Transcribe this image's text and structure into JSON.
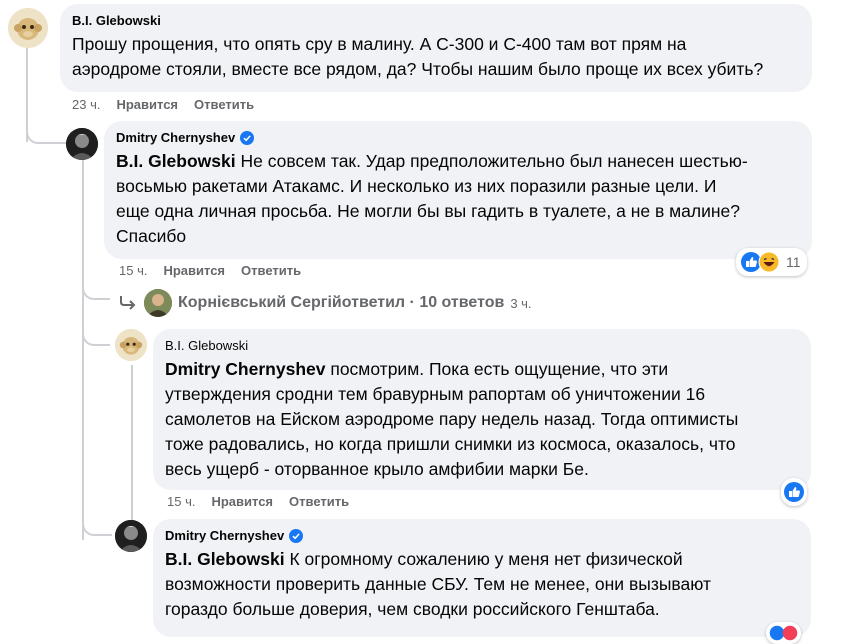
{
  "comment1": {
    "author": "B.I. Glebowski",
    "text": "Прошу прощения, что опять сру в малину. А С-300 и С-400 там вот прям на аэродроме стояли, вместе все рядом, да? Чтобы нашим было проще их всех убить?",
    "line1": "Прошу прощения, что опять сру в малину. А С-300 и С-400 там вот прям на",
    "line2": "аэродроме стояли, вместе все рядом, да? Чтобы нашим было проще их всех убить?",
    "time": "23 ч.",
    "like": "Нравится",
    "reply": "Ответить"
  },
  "comment2": {
    "author": "Dmitry Chernyshev",
    "mention": "B.I. Glebowski",
    "line1": " Не совсем так. Удар предположительно был нанесен шестью-",
    "line2": "восьмью ракетами Атакамс. И несколько из них поразили разные цели. И",
    "line3": "еще одна личная просьба. Не могли бы вы гадить в туалете, а не в малине?",
    "line4": "Спасибо",
    "time": "15 ч.",
    "like": "Нравится",
    "reply": "Ответить",
    "reaction_count": "11"
  },
  "replies_summary": {
    "author": "Корнієвський Сергій",
    "text": " ответил · 10 ответов",
    "time": "3 ч."
  },
  "comment3": {
    "author": "B.I. Glebowski",
    "mention": "Dmitry Chernyshev",
    "line1": " посмотрим. Пока есть ощущение, что эти",
    "line2": "утверждения сродни тем бравурным рапортам об уничтожении 16",
    "line3": "самолетов на Ейском аэродроме пару недель назад. Тогда оптимисты",
    "line4": "тоже радовались, но когда пришли снимки из космоса, оказалось, что",
    "line5": "весь ущерб - оторванное крыло амфибии марки Бе.",
    "time": "15 ч.",
    "like": "Нравится",
    "reply": "Ответить"
  },
  "comment4": {
    "author": "Dmitry Chernyshev",
    "mention": "B.I. Glebowski",
    "line1": " К огромному сожалению у меня нет физической",
    "line2": "возможности проверить данные СБУ. Тем не менее, они вызывают",
    "line3": "гораздо больше доверия, чем сводки российского Генштаба."
  },
  "colors": {
    "bubble": "#f0f2f5",
    "meta": "#65676b",
    "verified": "#1877f2",
    "like": "#1877f2"
  }
}
